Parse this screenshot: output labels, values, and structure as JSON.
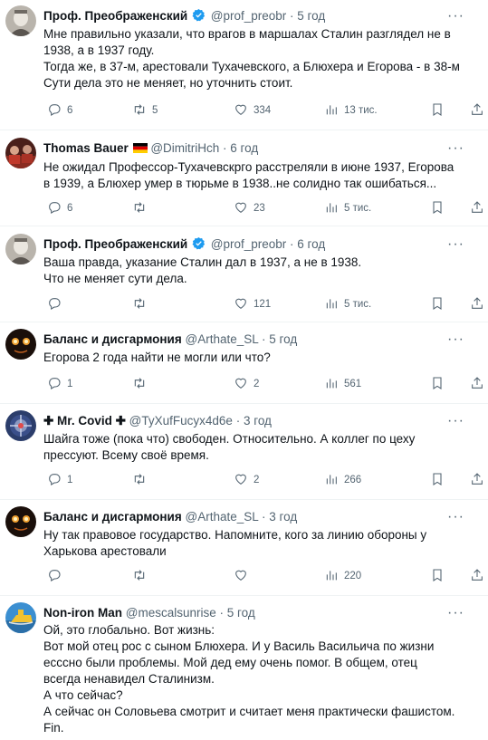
{
  "tweets": [
    {
      "name": "Проф. Преображенский",
      "verified": true,
      "handle": "@prof_preobr",
      "time": "5 год",
      "lines": [
        "Мне правильно указали, что врагов в маршалах Сталин разглядел не в",
        "1938, а в 1937 году.",
        "Тогда же, в 37-м, арестовали Тухачевского, а Блюхера и Егорова - в 38-м",
        "Сути дела это не меняет, но уточнить стоит."
      ],
      "replies": "6",
      "retweets": "5",
      "likes": "334",
      "views": "13 тис."
    },
    {
      "name": "Thomas Bauer",
      "flag": true,
      "handle": "@DimitriHch",
      "time": "6 год",
      "lines": [
        "Не ожидал Профессор-Тухачевскрго расстреляли в июне 1937, Егорова",
        "в 1939, а Блюхер умер в тюрьме в 1938..не солидно так ошибаться..."
      ],
      "replies": "6",
      "retweets": "",
      "likes": "23",
      "views": "5 тис."
    },
    {
      "name": "Проф. Преображенский",
      "verified": true,
      "handle": "@prof_preobr",
      "time": "6 год",
      "lines": [
        "Ваша правда, указание Сталин дал в 1937, а не в 1938.",
        "Что не меняет сути дела."
      ],
      "replies": "",
      "retweets": "",
      "likes": "121",
      "views": "5 тис."
    },
    {
      "name": "Баланс и дисгармония",
      "handle": "@Arthate_SL",
      "time": "5 год",
      "lines": [
        "Егорова 2 года найти не могли или что?"
      ],
      "replies": "1",
      "retweets": "",
      "likes": "2",
      "views": "561"
    },
    {
      "name": "✚ Mr. Covid ✚",
      "handle": "@TyXufFucyx4d6e",
      "time": "3 год",
      "lines": [
        "Шайга тоже (пока что) свободен. Относительно. А коллег по цеху",
        "прессуют. Всему своё время."
      ],
      "replies": "1",
      "retweets": "",
      "likes": "2",
      "views": "266"
    },
    {
      "name": "Баланс и дисгармония",
      "handle": "@Arthate_SL",
      "time": "3 год",
      "lines": [
        "Ну так правовое государство. Напомните, кого за линию обороны у",
        "Харькова арестовали"
      ],
      "replies": "",
      "retweets": "",
      "likes": "",
      "views": "220"
    },
    {
      "name": "Non-iron Man",
      "handle": "@mescalsunrise",
      "time": "5 год",
      "lines": [
        "Ой, это глобально. Вот жизнь:",
        "Вот мой отец рос с сыном Блюхера. И у Василь Васильича по жизни",
        "есссно были проблемы. Мой дед ему очень помог. В общем, отец",
        "всегда ненавидел Сталинизм.",
        "А что сейчас?",
        "А сейчас он Соловьева смотрит и считает меня практически фашистом.",
        "Fin."
      ],
      "replies": "",
      "retweets": "",
      "likes": "",
      "views": ""
    }
  ],
  "separator": "·",
  "more_label": "···",
  "colors": {
    "text": "#0f1419",
    "secondary": "#536471",
    "verified": "#1d9bf0",
    "border": "#eff3f4"
  }
}
